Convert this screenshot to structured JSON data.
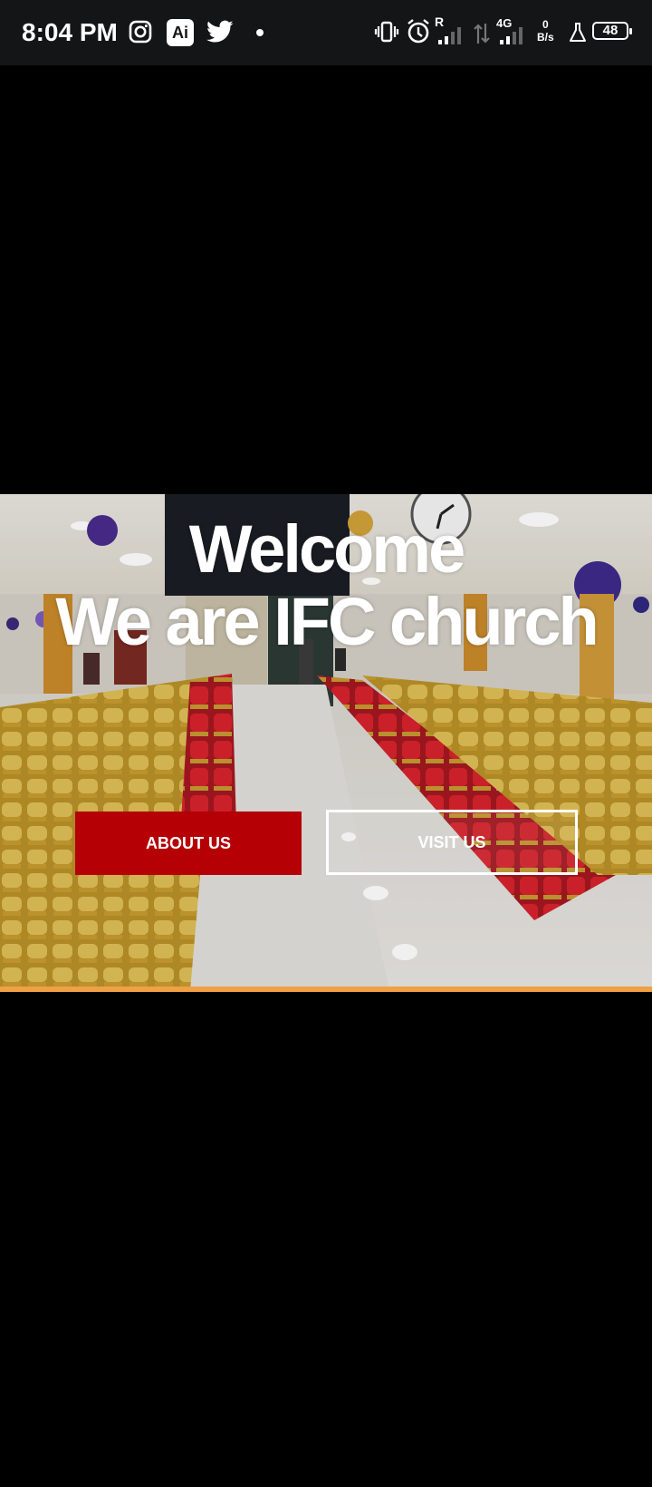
{
  "status_bar": {
    "time": "8:04 PM",
    "left_icons": [
      "instagram-icon",
      "ai-app-icon",
      "twitter-icon",
      "dot-icon"
    ],
    "ai_icon_label": "Ai",
    "right_icons": [
      "vibrate-icon",
      "alarm-icon",
      "signal-r-icon",
      "data-transfer-icon",
      "signal-4g-icon",
      "network-speed",
      "lab-icon",
      "battery-icon"
    ],
    "roaming_label": "R",
    "network_type": "4G",
    "speed_value": "0",
    "speed_unit": "B/s",
    "battery_level": "48"
  },
  "hero": {
    "title_line1": "Welcome",
    "title_line2": "We are IFC church",
    "about_button": "ABOUT US",
    "visit_button": "VISIT US",
    "colors": {
      "about_button_bg": "#b50006",
      "accent_bar": "#f0a045",
      "chair_gold": "#d7b34a",
      "chair_red": "#d3202a"
    }
  }
}
